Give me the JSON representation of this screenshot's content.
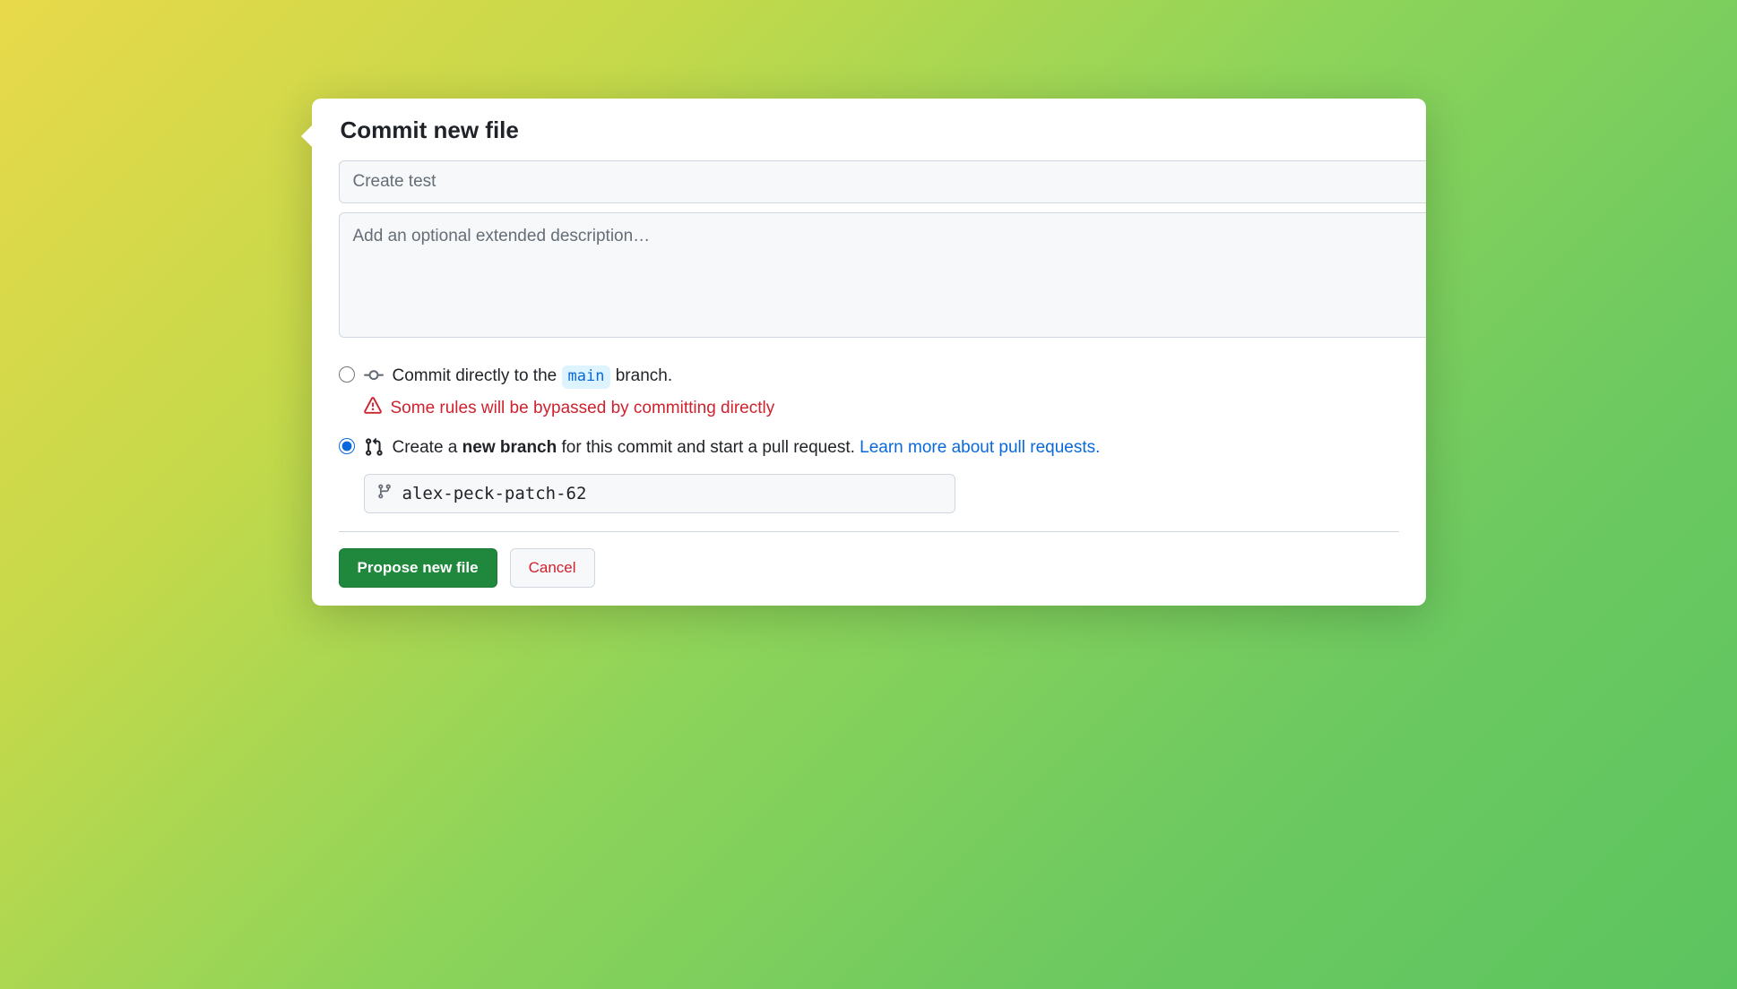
{
  "dialog": {
    "title": "Commit new file",
    "summary_placeholder": "Create test",
    "description_placeholder": "Add an optional extended description…"
  },
  "options": {
    "direct": {
      "text_prefix": "Commit directly to the ",
      "branch_name": "main",
      "text_suffix": " branch.",
      "warning": "Some rules will be bypassed by committing directly"
    },
    "new_branch": {
      "text_prefix": "Create a ",
      "bold_text": "new branch",
      "text_suffix": " for this commit and start a pull request. ",
      "link_text": "Learn more about pull requests.",
      "branch_value": "alex-peck-patch-62"
    }
  },
  "buttons": {
    "propose": "Propose new file",
    "cancel": "Cancel"
  }
}
